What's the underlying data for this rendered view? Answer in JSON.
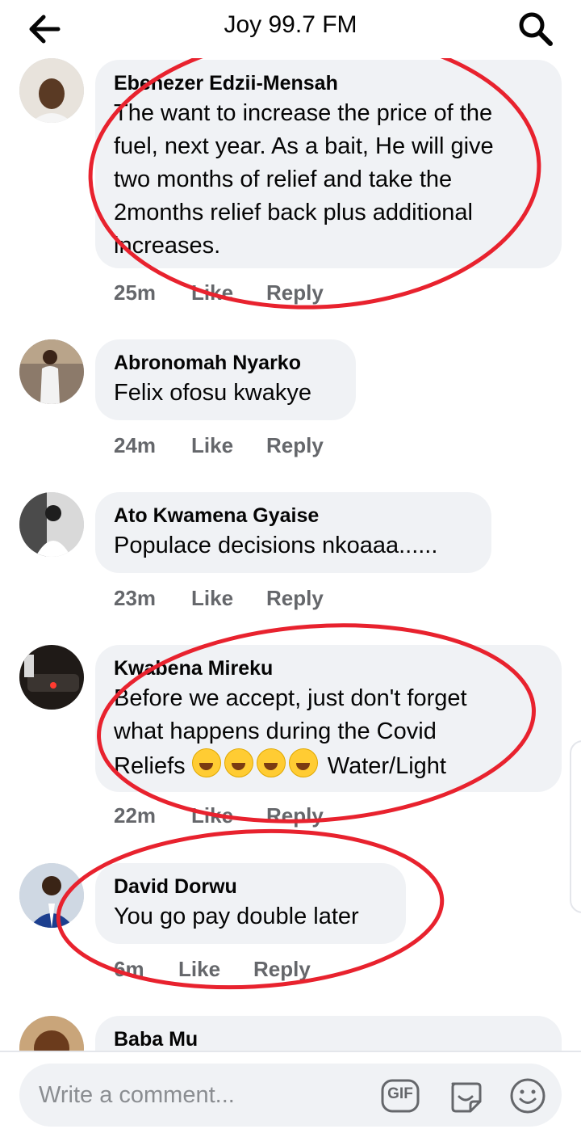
{
  "header": {
    "title": "Joy 99.7 FM"
  },
  "comments": [
    {
      "author": "Ebenezer Edzii-Mensah",
      "lines": [
        "The want to increase the price of the",
        "fuel, next year. As a bait, He will give",
        "two months of relief and take the",
        "2months relief back plus additional",
        "increases."
      ],
      "time": "25m",
      "like": "Like",
      "reply": "Reply"
    },
    {
      "author": "Abronomah Nyarko",
      "lines": [
        "Felix ofosu kwakye"
      ],
      "time": "24m",
      "like": "Like",
      "reply": "Reply"
    },
    {
      "author": "Ato Kwamena Gyaise",
      "lines": [
        "Populace decisions nkoaaa......"
      ],
      "time": "23m",
      "like": "Like",
      "reply": "Reply"
    },
    {
      "author": "Kwabena Mireku",
      "lines": [
        "Before we accept, just don't forget",
        "what happens during the Covid"
      ],
      "line3_before": "Reliefs",
      "line3_after": "Water/Light",
      "emoji_name": "rolling-on-floor-laughing",
      "time": "22m",
      "like": "Like",
      "reply": "Reply"
    },
    {
      "author": "David Dorwu",
      "lines": [
        "You go pay double later"
      ],
      "time": "6m",
      "like": "Like",
      "reply": "Reply"
    },
    {
      "author": "Baba Mu",
      "lines": []
    }
  ],
  "composer": {
    "placeholder": "Write a comment...",
    "gif_label": "GIF"
  },
  "icons": {
    "back": "arrow-left-icon",
    "search": "search-icon",
    "gif": "gif-icon",
    "sticker": "sticker-icon",
    "emoji": "smiley-icon"
  },
  "colors": {
    "bubble": "#f0f2f5",
    "meta": "#65676b",
    "annotation": "#e8222e",
    "text": "#050505"
  }
}
